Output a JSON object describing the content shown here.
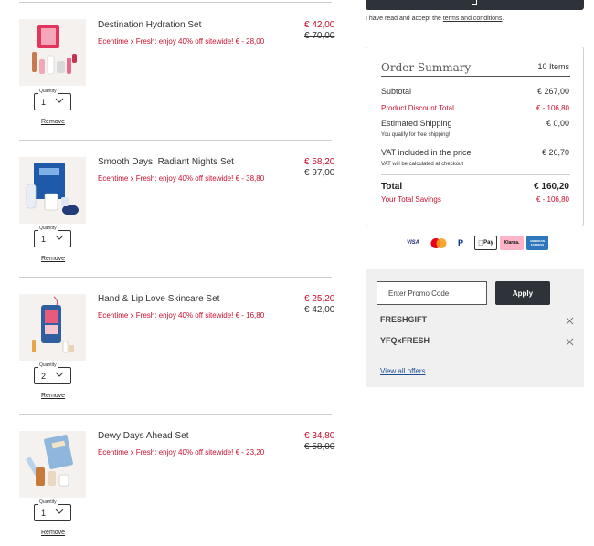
{
  "cart": {
    "quantity_label": "Quantity",
    "remove_label": "Remove",
    "items": [
      {
        "name": "Destination Hydration Set",
        "promo": "Ecentime x Fresh: enjoy 40% off sitewide! € - 28,00",
        "price_now": "€ 42,00",
        "price_was": "€ 70,00",
        "quantity": "1"
      },
      {
        "name": "Smooth Days, Radiant Nights Set",
        "promo": "Ecentime x Fresh: enjoy 40% off sitewide! € - 38,80",
        "price_now": "€ 58,20",
        "price_was": "€ 97,00",
        "quantity": "1"
      },
      {
        "name": "Hand & Lip Love Skincare Set",
        "promo": "Ecentime x Fresh: enjoy 40% off sitewide! € - 16,80",
        "price_now": "€ 25,20",
        "price_was": "€ 42,00",
        "quantity": "2"
      },
      {
        "name": "Dewy Days Ahead Set",
        "promo": "Ecentime x Fresh: enjoy 40% off sitewide! € - 23,20",
        "price_now": "€ 34,80",
        "price_was": "€ 58,00",
        "quantity": "1"
      }
    ]
  },
  "terms": {
    "prefix": "I have read and accept the ",
    "link": "terms and conditions",
    "suffix": "."
  },
  "summary": {
    "title": "Order Summary",
    "count": "10 Items",
    "subtotal_label": "Subtotal",
    "subtotal_value": "€ 267,00",
    "discount_label": "Product Discount Total",
    "discount_value": "€ - 106,80",
    "shipping_label": "Estimated Shipping",
    "shipping_value": "€ 0,00",
    "shipping_note": "You qualify for free shipping!",
    "vat_label": "VAT included in the price",
    "vat_value": "€ 26,70",
    "vat_note": "VAT will be calculated at checkout",
    "total_label": "Total",
    "total_value": "€ 160,20",
    "savings_label": "Your Total Savings",
    "savings_value": "€ - 106,80"
  },
  "payments": [
    {
      "icon": "visa-icon",
      "label": "VISA"
    },
    {
      "icon": "mastercard-icon",
      "label": ""
    },
    {
      "icon": "paypal-icon",
      "label": "P"
    },
    {
      "icon": "apple-pay-icon",
      "label": "Pay"
    },
    {
      "icon": "klarna-icon",
      "label": "Klarna."
    },
    {
      "icon": "amex-icon",
      "label": "AMERICAN EXPRESS"
    }
  ],
  "promo": {
    "placeholder": "Enter Promo Code",
    "apply_label": "Apply",
    "codes": [
      "FRESHGIFT",
      "YFQxFRESH"
    ],
    "view_all": "View all offers"
  },
  "colors": {
    "accent_red": "#c8102e",
    "dark_button": "#2d3339",
    "link_blue": "#1d4f91"
  }
}
